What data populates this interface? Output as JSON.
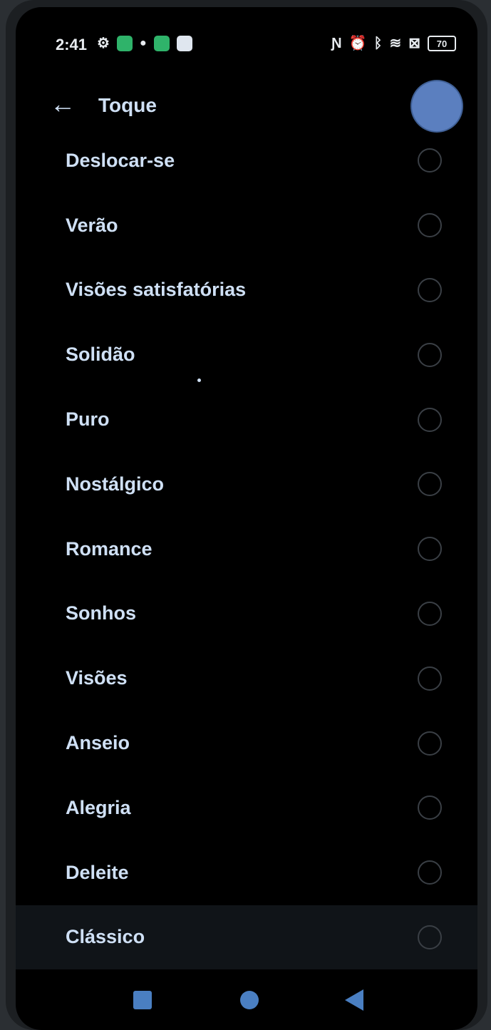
{
  "status_bar": {
    "time": "2:41",
    "battery": "70",
    "left_icons": [
      "settings-icon",
      "app-grid-icon",
      "notification-icon",
      "app-icon",
      "app-icon"
    ],
    "right_icons": [
      "nfc-icon",
      "alarm-icon",
      "bluetooth-icon",
      "wifi-icon",
      "sim-off-icon",
      "battery-icon"
    ]
  },
  "header": {
    "title": "Toque",
    "back_icon": "arrow-left-icon"
  },
  "ringtones": [
    {
      "label": "Deslocar-se"
    },
    {
      "label": "Verão"
    },
    {
      "label": "Visões satisfatórias"
    },
    {
      "label": "Solidão"
    },
    {
      "label": "Puro"
    },
    {
      "label": "Nostálgico"
    },
    {
      "label": "Romance"
    },
    {
      "label": "Sonhos"
    },
    {
      "label": "Visões"
    },
    {
      "label": "Anseio"
    },
    {
      "label": "Alegria"
    },
    {
      "label": "Deleite"
    },
    {
      "label": "Clássico"
    }
  ],
  "nav_bar": {
    "recents_icon": "square-icon",
    "home_icon": "circle-icon",
    "back_icon": "triangle-back-icon"
  },
  "colors": {
    "accent": "#4a7fc2",
    "label": "#cfe0f5",
    "background": "#000000"
  }
}
